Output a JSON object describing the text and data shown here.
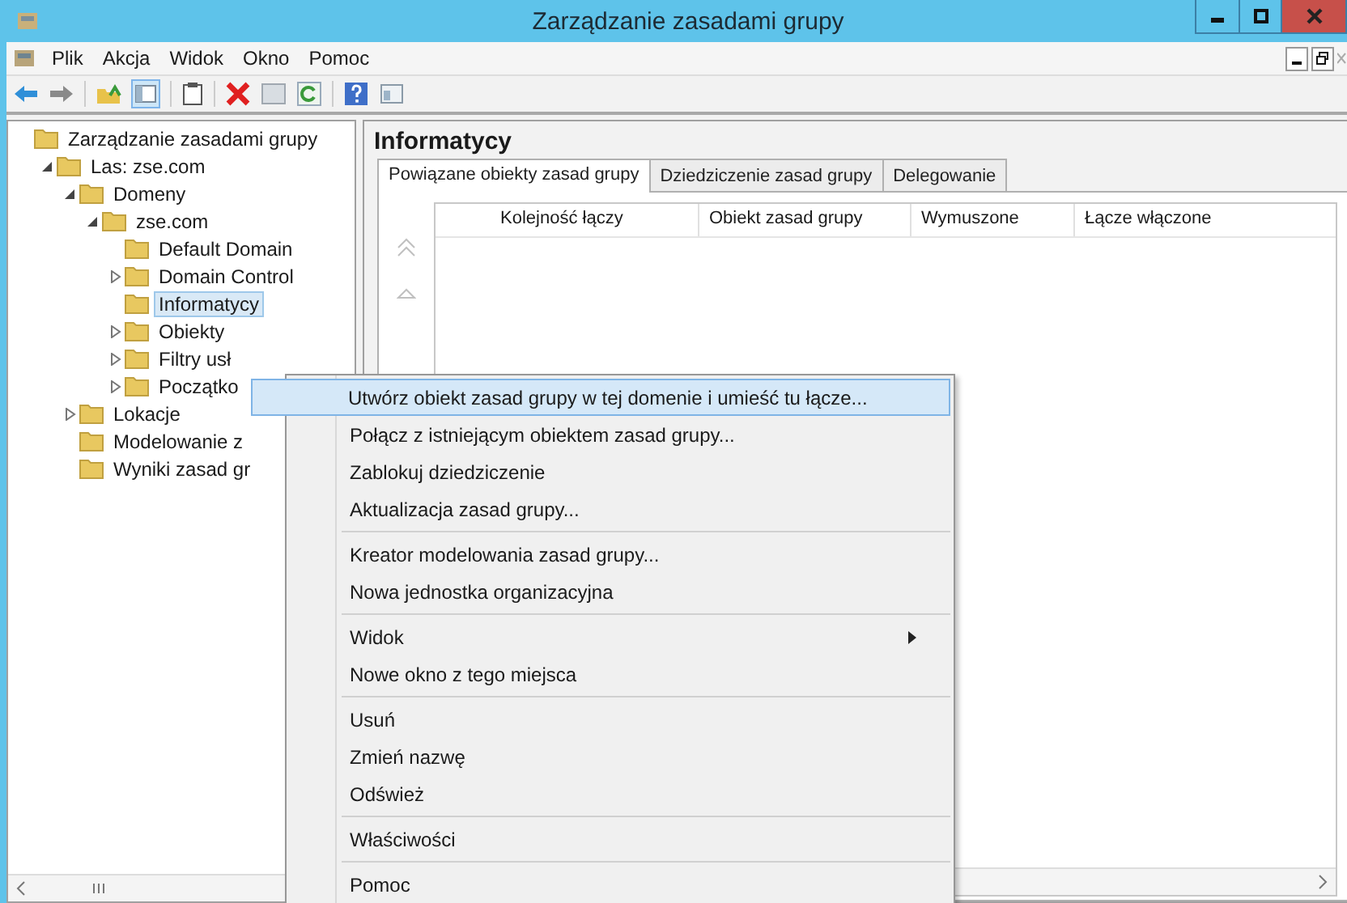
{
  "window": {
    "title": "Zarządzanie zasadami grupy"
  },
  "menu_bar": [
    "Plik",
    "Akcja",
    "Widok",
    "Okno",
    "Pomoc"
  ],
  "tree": [
    {
      "label": "Zarządzanie zasadami grupy",
      "kind": "plain",
      "selected": false,
      "children": [
        {
          "label": "Las: zse.com",
          "kind": "expander",
          "expanded": true,
          "selected": false,
          "children": [
            {
              "label": "Domeny",
              "kind": "expander",
              "expanded": true,
              "selected": false,
              "children": [
                {
                  "label": "zse.com",
                  "kind": "expander",
                  "expanded": true,
                  "selected": false,
                  "children": [
                    {
                      "label": "Default Domain",
                      "kind": "plain",
                      "selected": false
                    },
                    {
                      "label": "Domain Control",
                      "kind": "expander",
                      "expanded": false,
                      "selected": false
                    },
                    {
                      "label": "Informatycy",
                      "kind": "plain",
                      "selected": true
                    },
                    {
                      "label": "Obiekty",
                      "kind": "expander",
                      "expanded": false,
                      "selected": false
                    },
                    {
                      "label": "Filtry usł",
                      "kind": "expander",
                      "expanded": false,
                      "selected": false
                    },
                    {
                      "label": "Początko",
                      "kind": "expander",
                      "expanded": false,
                      "selected": false
                    }
                  ]
                }
              ]
            },
            {
              "label": "Lokacje",
              "kind": "expander",
              "expanded": false,
              "selected": false
            },
            {
              "label": "Modelowanie z",
              "kind": "plain",
              "selected": false
            },
            {
              "label": "Wyniki zasad gr",
              "kind": "plain",
              "selected": false
            }
          ]
        }
      ]
    }
  ],
  "details": {
    "heading": "Informatycy",
    "tabs": [
      {
        "label": "Powiązane obiekty zasad grupy",
        "selected": true
      },
      {
        "label": "Dziedziczenie zasad grupy",
        "selected": false
      },
      {
        "label": "Delegowanie",
        "selected": false
      }
    ],
    "table": {
      "columns": [
        "Kolejność łączy",
        "Obiekt zasad grupy",
        "Wymuszone",
        "Łącze włączone"
      ]
    }
  },
  "context_menu": [
    [
      {
        "label": "Utwórz obiekt zasad grupy w tej domenie i umieść tu łącze...",
        "selected": true,
        "submenu": false
      },
      {
        "label": "Połącz z istniejącym obiektem zasad grupy...",
        "selected": false,
        "submenu": false
      },
      {
        "label": "Zablokuj dziedziczenie",
        "selected": false,
        "submenu": false
      },
      {
        "label": "Aktualizacja zasad grupy...",
        "selected": false,
        "submenu": false
      }
    ],
    [
      {
        "label": "Kreator modelowania zasad grupy...",
        "selected": false,
        "submenu": false
      },
      {
        "label": "Nowa jednostka organizacyjna",
        "selected": false,
        "submenu": false
      }
    ],
    [
      {
        "label": "Widok",
        "selected": false,
        "submenu": true
      },
      {
        "label": "Nowe okno z tego miejsca",
        "selected": false,
        "submenu": false
      }
    ],
    [
      {
        "label": "Usuń",
        "selected": false,
        "submenu": false
      },
      {
        "label": "Zmień nazwę",
        "selected": false,
        "submenu": false
      },
      {
        "label": "Odśwież",
        "selected": false,
        "submenu": false
      }
    ],
    [
      {
        "label": "Właściwości",
        "selected": false,
        "submenu": false
      }
    ],
    [
      {
        "label": "Pomoc",
        "selected": false,
        "submenu": false
      }
    ]
  ]
}
